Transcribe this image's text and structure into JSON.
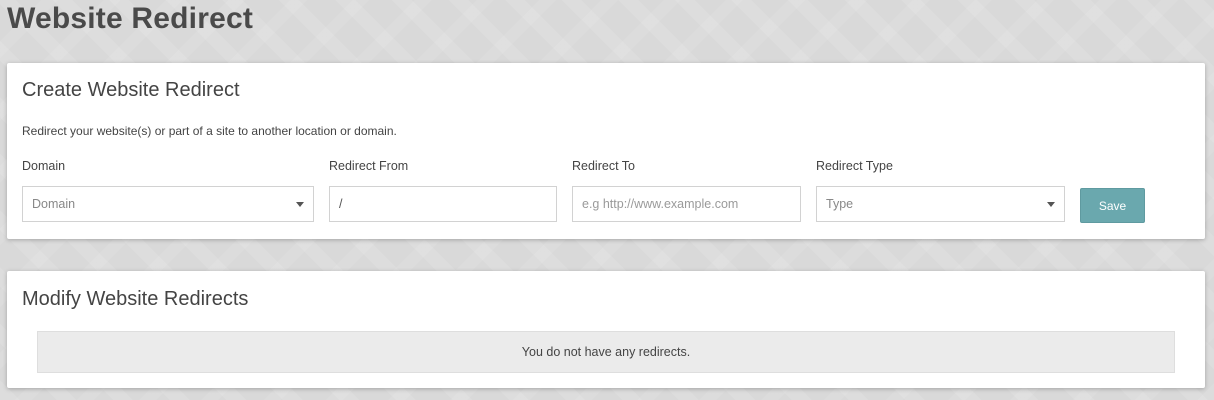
{
  "page": {
    "title": "Website Redirect"
  },
  "create": {
    "heading": "Create Website Redirect",
    "description": "Redirect your website(s) or part of a site to another location or domain.",
    "domain": {
      "label": "Domain",
      "value": "Domain"
    },
    "redirect_from": {
      "label": "Redirect From",
      "value": "/"
    },
    "redirect_to": {
      "label": "Redirect To",
      "placeholder": "e.g http://www.example.com",
      "value": ""
    },
    "redirect_type": {
      "label": "Redirect Type",
      "value": "Type"
    },
    "save_label": "Save"
  },
  "modify": {
    "heading": "Modify Website Redirects",
    "empty_message": "You do not have any redirects."
  },
  "colors": {
    "save_button": "#6aa8ae",
    "background": "#d9d9d9",
    "panel": "#ffffff"
  },
  "icons": {
    "dropdown": "caret-down-icon"
  }
}
